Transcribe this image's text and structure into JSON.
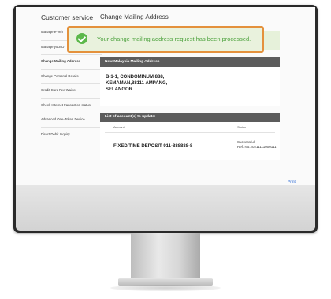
{
  "sidebar": {
    "title": "Customer service",
    "items": [
      {
        "label": "Manage e-Veh"
      },
      {
        "label": "Manage your D"
      },
      {
        "label": "Change Mailing Address"
      },
      {
        "label": "Change Personal Details"
      },
      {
        "label": "Credit Card Fee Waiver"
      },
      {
        "label": "Check Internet transaction status"
      },
      {
        "label": "Advanced One-Token Device"
      },
      {
        "label": "Direct Debit Inquiry"
      }
    ]
  },
  "main": {
    "title": "Change Mailing Address",
    "toast": "Your change mailing address request has been processed.",
    "address_panel": {
      "heading": "New Malaysia Mailing Address",
      "lines": [
        "B-1-1, CONDOMINUM 888,",
        "KEMAMAN,88111 AMPANG,",
        "SELANGOR"
      ]
    },
    "accounts_panel": {
      "heading": "List of account(s) to update:",
      "col_account": "Account",
      "col_status": "Status",
      "rows": [
        {
          "account": "FIXED/TIME DEPOSIT 911-888888-8",
          "status": "Successful",
          "ref": "Ref. No:20211111000111"
        }
      ]
    },
    "print_label": "Print"
  },
  "colors": {
    "toast_border": "#e4913c",
    "success_green": "#4ca23d",
    "panel_header": "#5c5c5c",
    "link_blue": "#2d6bd6"
  },
  "icons": {
    "success": "check-circle-icon",
    "active_item": "chevron-right-icon"
  }
}
